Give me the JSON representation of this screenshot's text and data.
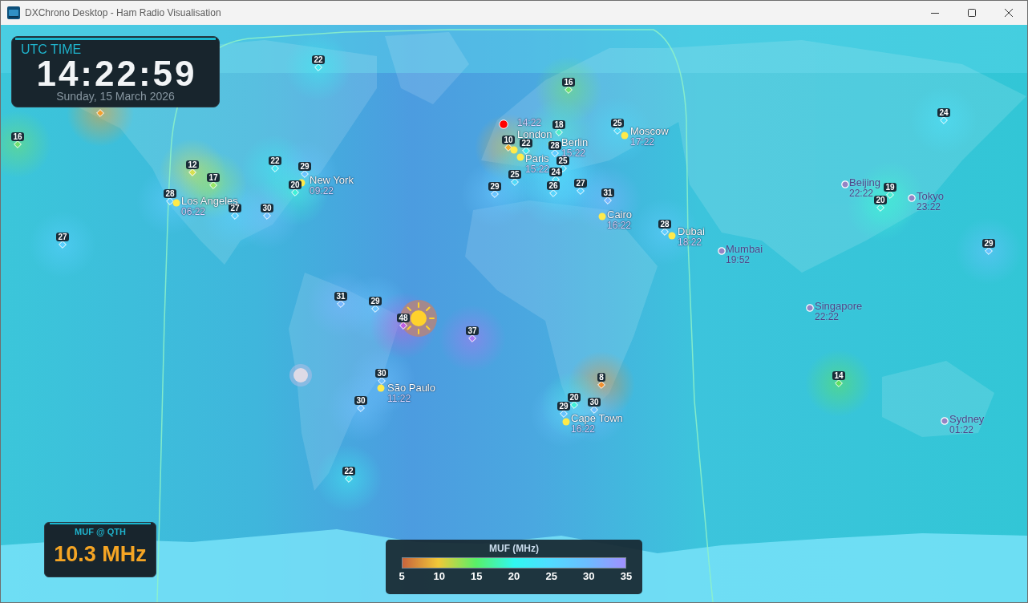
{
  "window": {
    "title": "DXChrono Desktop - Ham Radio Visualisation"
  },
  "clock": {
    "label": "UTC TIME",
    "time": "14:22:59",
    "date": "Sunday, 15 March 2026"
  },
  "map": {
    "qth": {
      "time": "14:22"
    },
    "cities": [
      {
        "name": "London",
        "daylight": true
      },
      {
        "name": "Berlin",
        "time": "15:22",
        "daylight": true
      },
      {
        "name": "Moscow",
        "time": "17:22",
        "daylight": true
      },
      {
        "name": "Paris",
        "time": "15:22",
        "daylight": true
      },
      {
        "name": "Los Angeles",
        "time": "06:22",
        "daylight": true
      },
      {
        "name": "New York",
        "time": "09:22",
        "daylight": true
      },
      {
        "name": "Beijing",
        "time": "22:22",
        "daylight": false
      },
      {
        "name": "Cairo",
        "time": "16:22",
        "daylight": true
      },
      {
        "name": "Tokyo",
        "time": "23:22",
        "daylight": false
      },
      {
        "name": "Dubai",
        "time": "18:22",
        "daylight": true
      },
      {
        "name": "Mumbai",
        "time": "19:52",
        "daylight": false
      },
      {
        "name": "Singapore",
        "time": "22:22",
        "daylight": false
      },
      {
        "name": "São Paulo",
        "time": "11:22",
        "daylight": true
      },
      {
        "name": "Cape Town",
        "time": "16:22",
        "daylight": true
      },
      {
        "name": "Sydney",
        "time": "01:22",
        "daylight": false
      }
    ],
    "muf_points": [
      {
        "value": "22",
        "color": "#40e8f0"
      },
      {
        "value": "16",
        "color": "#70e070"
      },
      {
        "color": "#f0a030"
      },
      {
        "value": "24",
        "color": "#50e0f8"
      },
      {
        "value": "18",
        "color": "#50ecc8"
      },
      {
        "value": "25",
        "color": "#50d8f8"
      },
      {
        "value": "16",
        "color": "#70e070"
      },
      {
        "value": "10",
        "color": "#f0b030"
      },
      {
        "value": "22",
        "color": "#40e8f0"
      },
      {
        "value": "28",
        "color": "#60ccff"
      },
      {
        "value": "12",
        "color": "#d8e050"
      },
      {
        "value": "22",
        "color": "#40e8f0"
      },
      {
        "value": "29",
        "color": "#68c4ff"
      },
      {
        "value": "25",
        "color": "#50d8f8"
      },
      {
        "value": "17",
        "color": "#98e868"
      },
      {
        "value": "25",
        "color": "#50d8f8"
      },
      {
        "value": "24",
        "color": "#50e0f8"
      },
      {
        "value": "20",
        "color": "#40f0d8"
      },
      {
        "value": "29",
        "color": "#68c4ff"
      },
      {
        "value": "26",
        "color": "#58d4fc"
      },
      {
        "value": "27",
        "color": "#58d0ff"
      },
      {
        "value": "28",
        "color": "#60ccff"
      },
      {
        "value": "31",
        "color": "#78b8ff"
      },
      {
        "value": "19",
        "color": "#48eed0"
      },
      {
        "value": "20",
        "color": "#40f0d8"
      },
      {
        "value": "27",
        "color": "#58d0ff"
      },
      {
        "value": "30",
        "color": "#70c0ff"
      },
      {
        "value": "28",
        "color": "#60ccff"
      },
      {
        "value": "27",
        "color": "#58d0ff"
      },
      {
        "value": "29",
        "color": "#68c4ff"
      },
      {
        "value": "31",
        "color": "#78b8ff"
      },
      {
        "value": "29",
        "color": "#68c4ff"
      },
      {
        "value": "48",
        "color": "#c060e0"
      },
      {
        "value": "37",
        "color": "#a878f0"
      },
      {
        "value": "30",
        "color": "#70c0ff"
      },
      {
        "value": "8",
        "color": "#f09030"
      },
      {
        "value": "14",
        "color": "#60e060"
      },
      {
        "value": "30",
        "color": "#70c0ff"
      },
      {
        "value": "20",
        "color": "#40f0d8"
      },
      {
        "value": "29",
        "color": "#68c4ff"
      },
      {
        "value": "30",
        "color": "#70c0ff"
      },
      {
        "value": "22",
        "color": "#40e8f0"
      }
    ]
  },
  "muf_at_qth": {
    "label": "MUF @ QTH",
    "value": "10.3 MHz"
  },
  "legend": {
    "title": "MUF (MHz)",
    "ticks": [
      "5",
      "10",
      "15",
      "20",
      "25",
      "30",
      "35"
    ]
  }
}
